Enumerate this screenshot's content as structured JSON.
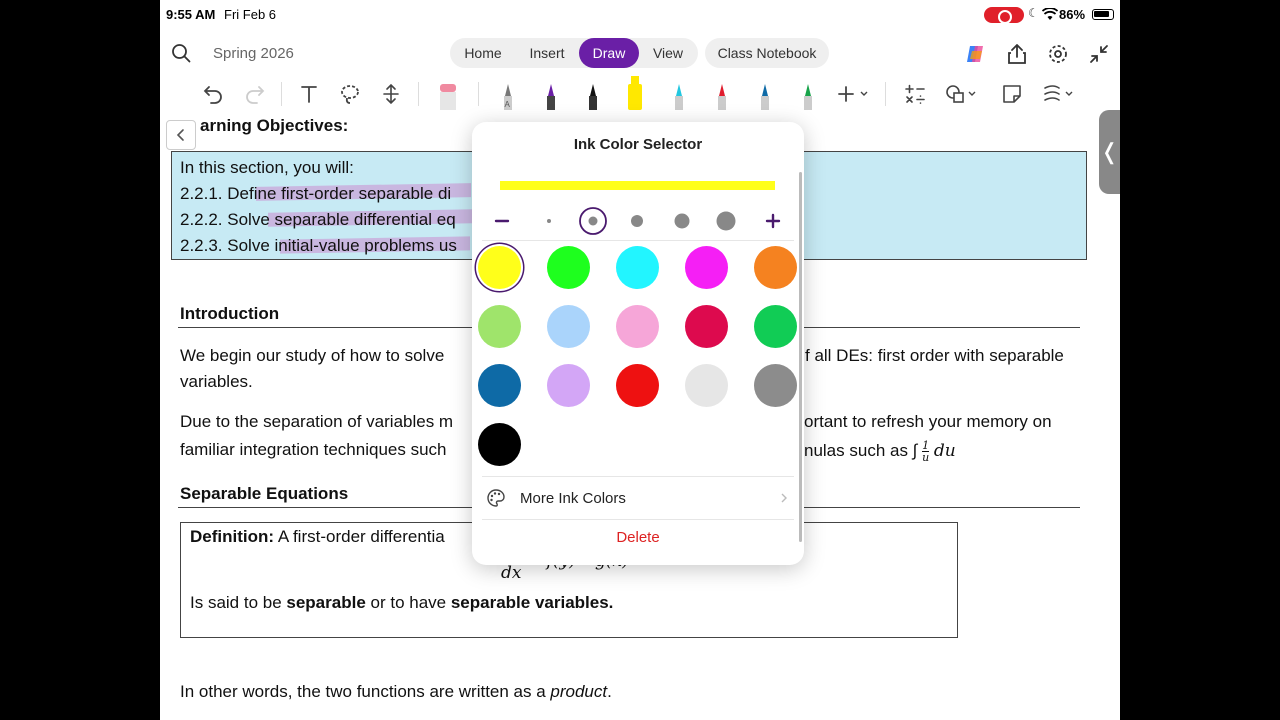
{
  "status": {
    "time": "9:55 AM",
    "date": "Fri Feb 6",
    "battery": "86%"
  },
  "header": {
    "notebook_title": "Spring 2026",
    "tabs": [
      {
        "label": "Home"
      },
      {
        "label": "Insert"
      },
      {
        "label": "Draw",
        "active": true
      },
      {
        "label": "View"
      }
    ],
    "class_notebook": "Class Notebook"
  },
  "doc": {
    "lo_title": "arning Objectives:",
    "objectives": [
      "In this section, you will:",
      "2.2.1. Define first-order separable di",
      "2.2.2. Solve separable differential eq",
      "2.2.3. Solve initial-value problems us"
    ],
    "intro_heading": "Introduction",
    "intro_left_1": "We begin our study of how to solve",
    "intro_right_1": "f all DEs: first order with separable",
    "intro_line_2": "variables.",
    "due_left": "Due to the separation of variables m",
    "due_right": "ortant to refresh your memory on",
    "familiar_left": "familiar integration techniques such",
    "familiar_right": "nulas such as ∫",
    "familiar_formula": "du",
    "frac_num": "1",
    "frac_den": "u",
    "sep_heading": "Separable Equations",
    "def_bold": "Definition:",
    "def_text": " A first-order differentia",
    "formula_frac": "dx",
    "formula_rhs": "= f(y) * g(x)",
    "def_line2_pre": "Is said to be ",
    "def_line2_b1": "separable",
    "def_line2_mid": " or to have ",
    "def_line2_b2": "separable variables.",
    "other_words": "In other words, the two functions are written as a ",
    "other_words_em": "product",
    "other_words_end": "."
  },
  "popup": {
    "title": "Ink Color Selector",
    "selected_color": "#ffff1a",
    "selected_size_index": 1,
    "swatches": [
      "#ffff1a",
      "#1eff1e",
      "#22f5ff",
      "#f51ff5",
      "#f58220",
      "#9fe46b",
      "#aad4fb",
      "#f6a6d8",
      "#dd0a4e",
      "#11cc55",
      "#0e6aa6",
      "#d3a6f6",
      "#ee1111",
      "#e6e6e6",
      "#8c8c8c",
      "#000000"
    ],
    "more_label": "More Ink Colors",
    "delete_label": "Delete"
  },
  "icons": {
    "search": "search-icon",
    "copilot": "copilot-icon",
    "share": "share-icon",
    "settings": "gear-icon",
    "collapse": "collapse-icon"
  }
}
